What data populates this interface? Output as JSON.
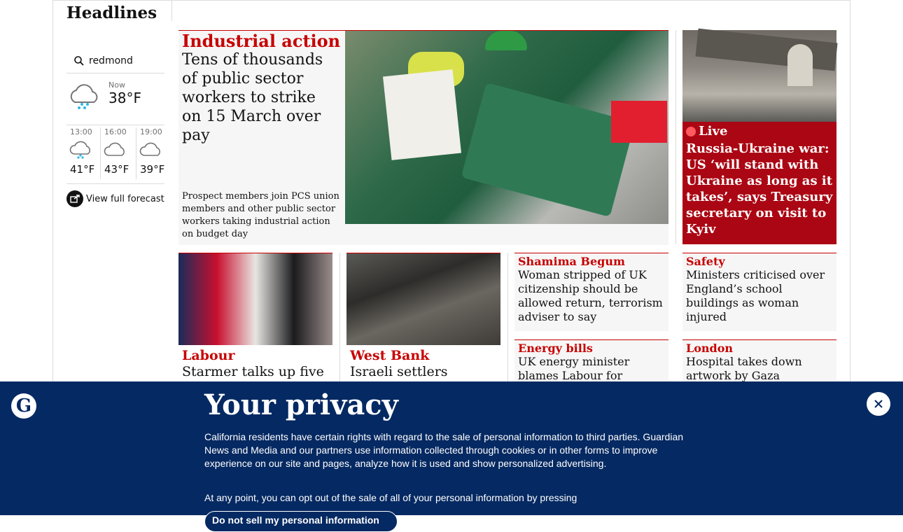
{
  "section": {
    "title": "Headlines"
  },
  "weather": {
    "location": "redmond",
    "now_label": "Now",
    "now_temp": "38°F",
    "hourly": [
      {
        "time": "13:00",
        "temp": "41°F",
        "icon": "rain-cloud-icon"
      },
      {
        "time": "16:00",
        "temp": "43°F",
        "icon": "cloud-icon"
      },
      {
        "time": "19:00",
        "temp": "39°F",
        "icon": "cloud-icon"
      }
    ],
    "forecast_link": "View full forecast"
  },
  "main_story": {
    "kicker": "Industrial action",
    "headline": "Tens of thousands of public sector workers to strike on 15 March over pay",
    "standfirst": "Prospect members join PCS union members and other public sector workers taking industrial action on budget day"
  },
  "live_story": {
    "badge": "Live",
    "headline": "Russia-Ukraine war: US ‘will stand with Ukraine as long as it takes’, says Treasury secretary on visit to Kyiv"
  },
  "cards": [
    {
      "kicker": "Labour",
      "headline": "Starmer talks up five"
    },
    {
      "kicker": "West Bank",
      "headline": "Israeli settlers"
    }
  ],
  "small_cards": [
    {
      "kicker": "Shamima Begum",
      "headline": "Woman stripped of UK citizenship should be allowed return, terrorism adviser to say"
    },
    {
      "kicker": "Safety",
      "headline": "Ministers criticised over England’s school buildings as woman injured"
    },
    {
      "kicker": "Energy bills",
      "headline": "UK energy minister blames Labour for soaring costs"
    },
    {
      "kicker": "London",
      "headline": "Hospital takes down artwork by Gaza"
    }
  ],
  "privacy": {
    "logo_letter": "G",
    "title": "Your privacy",
    "body1": "California residents have certain rights with regard to the sale of personal information to third parties. Guardian News and Media and our partners use information collected through cookies or in other forms to improve experience on our site and pages, analyze how it is used and show personalized advertising.",
    "body2": "At any point, you can opt out of the sale of all of your personal information by pressing",
    "button": "Do not sell my personal information"
  }
}
